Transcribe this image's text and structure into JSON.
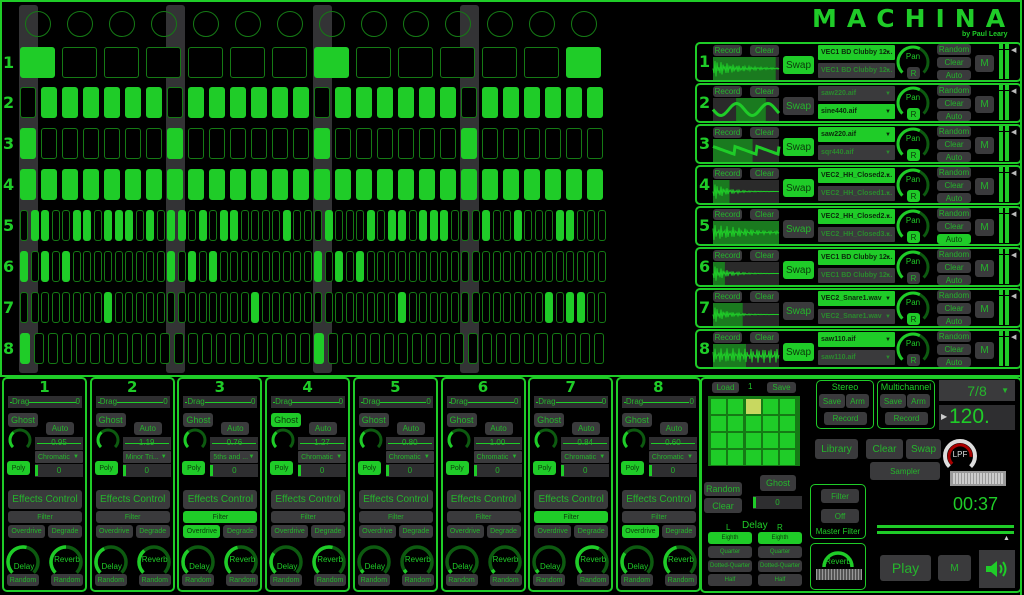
{
  "app": {
    "title": "MACHINA",
    "subtitle": "by Paul Leary"
  },
  "colors": {
    "accent": "#1fcc28",
    "inactive_step_border": "#157a15",
    "button": "#3a3a3c",
    "button_text": "#25b52c",
    "highlight_pad": "#c8d860",
    "background": "#000000"
  },
  "sequencer": {
    "row_labels": [
      "1",
      "2",
      "3",
      "4",
      "5",
      "6",
      "7",
      "8"
    ],
    "rows": [
      {
        "steps": 14,
        "active": [
          0,
          7,
          13
        ]
      },
      {
        "steps": 28,
        "active": [
          1,
          2,
          3,
          4,
          5,
          6,
          8,
          9,
          10,
          11,
          12,
          13,
          15,
          16,
          17,
          18,
          19,
          20,
          22,
          23,
          24,
          25,
          26,
          27
        ]
      },
      {
        "steps": 28,
        "active": [
          0,
          7,
          14,
          21
        ]
      },
      {
        "steps": 28,
        "active": [
          0,
          1,
          2,
          3,
          4,
          5,
          6,
          7,
          8,
          9,
          10,
          11,
          12,
          13,
          14,
          15,
          16,
          17,
          18,
          19,
          20,
          21,
          22,
          23,
          24,
          25,
          26,
          27
        ]
      },
      {
        "steps": 56,
        "active": [
          1,
          2,
          5,
          6,
          8,
          9,
          10,
          12,
          14,
          15,
          17,
          19,
          20,
          25,
          29,
          33,
          35,
          36,
          38,
          39,
          40,
          44,
          47,
          51,
          52
        ]
      },
      {
        "steps": 56,
        "active": [
          0,
          2,
          4,
          14,
          16,
          18,
          28,
          30,
          32
        ]
      },
      {
        "steps": 56,
        "active": [
          8,
          22,
          36,
          50,
          52,
          53
        ]
      },
      {
        "steps": 42,
        "active": [
          0,
          21
        ]
      }
    ]
  },
  "tracks": [
    {
      "number": "1",
      "record": "Record",
      "clear": "Clear",
      "swap": "Swap",
      "swap_active": true,
      "sample_a": "VEC1 BD Clubby 12...",
      "sample_a_active": true,
      "sample_b": "VEC1 BD Clubby 12...",
      "sample_b_active": false,
      "pan": "Pan",
      "r": "R",
      "r_active": false,
      "random": "Random",
      "clear2": "Clear",
      "auto": "Auto",
      "auto_active": false,
      "mute": "M",
      "selection": [
        0,
        0.95
      ]
    },
    {
      "number": "2",
      "record": "Record",
      "clear": "Clear",
      "swap": "Swap",
      "swap_active": false,
      "sample_a": "saw220.aif",
      "sample_a_active": false,
      "sample_b": "sine440.aif",
      "sample_b_active": true,
      "pan": "Pan",
      "r": "R",
      "r_active": true,
      "random": "Random",
      "clear2": "Clear",
      "auto": "Auto",
      "auto_active": false,
      "mute": "M",
      "selection": [
        0.35,
        0.8
      ]
    },
    {
      "number": "3",
      "record": "Record",
      "clear": "Clear",
      "swap": "Swap",
      "swap_active": true,
      "sample_a": "saw220.aif",
      "sample_a_active": true,
      "sample_b": "sqr440.aif",
      "sample_b_active": false,
      "pan": "Pan",
      "r": "R",
      "r_active": true,
      "random": "Random",
      "clear2": "Clear",
      "auto": "Auto",
      "auto_active": false,
      "mute": "M",
      "selection": [
        0,
        0.6
      ]
    },
    {
      "number": "4",
      "record": "Record",
      "clear": "Clear",
      "swap": "Swap",
      "swap_active": true,
      "sample_a": "VEC2_HH_Closed2....",
      "sample_a_active": true,
      "sample_b": "VEC2_HH_Closed1....",
      "sample_b_active": false,
      "pan": "Pan",
      "r": "R",
      "r_active": true,
      "random": "Random",
      "clear2": "Clear",
      "auto": "Auto",
      "auto_active": false,
      "mute": "M",
      "selection": [
        0,
        0.25
      ]
    },
    {
      "number": "5",
      "record": "Record",
      "clear": "Clear",
      "swap": "Swap",
      "swap_active": false,
      "sample_a": "VEC2_HH_Closed2....",
      "sample_a_active": true,
      "sample_b": "VEC2_HH_Closed3....",
      "sample_b_active": false,
      "pan": "Pan",
      "r": "R",
      "r_active": true,
      "random": "Random",
      "clear2": "Clear",
      "auto": "Auto",
      "auto_active": true,
      "mute": "M",
      "selection": [
        0,
        1
      ]
    },
    {
      "number": "6",
      "record": "Record",
      "clear": "Clear",
      "swap": "Swap",
      "swap_active": true,
      "sample_a": "VEC1 BD Clubby 12...",
      "sample_a_active": true,
      "sample_b": "VEC1 BD Clubby 12...",
      "sample_b_active": false,
      "pan": "Pan",
      "r": "R",
      "r_active": false,
      "random": "Random",
      "clear2": "Clear",
      "auto": "Auto",
      "auto_active": false,
      "mute": "M",
      "selection": [
        0,
        0.18
      ]
    },
    {
      "number": "7",
      "record": "Record",
      "clear": "Clear",
      "swap": "Swap",
      "swap_active": false,
      "sample_a": "VEC2_Snare1.wav",
      "sample_a_active": true,
      "sample_b": "VEC2_Snare1.wav",
      "sample_b_active": false,
      "pan": "Pan",
      "r": "R",
      "r_active": true,
      "random": "Random",
      "clear2": "Clear",
      "auto": "Auto",
      "auto_active": false,
      "mute": "M",
      "selection": [
        0,
        0.45
      ]
    },
    {
      "number": "8",
      "record": "Record",
      "clear": "Clear",
      "swap": "Swap",
      "swap_active": true,
      "sample_a": "saw110.aif",
      "sample_a_active": true,
      "sample_b": "saw110.aif",
      "sample_b_active": false,
      "pan": "Pan",
      "r": "R",
      "r_active": false,
      "random": "Random",
      "clear2": "Clear",
      "auto": "Auto",
      "auto_active": false,
      "mute": "M",
      "selection": [
        0,
        0.5
      ]
    }
  ],
  "strips": [
    {
      "number": "1",
      "drag": "Drag",
      "drag_value": "0",
      "ghost": "Ghost",
      "ghost_active": false,
      "auto": "Auto",
      "value": "0.95",
      "scale": "Chromatic",
      "poly": "Poly",
      "offset": "0",
      "effects": "Effects Control",
      "filter": "Filter",
      "filter_active": false,
      "overdrive": "Overdrive",
      "overdrive_active": false,
      "degrade": "Degrade",
      "delay": "Delay",
      "reverb": "Reverb",
      "random": "Random",
      "delay_level": 0.55,
      "reverb_level": 0.5
    },
    {
      "number": "2",
      "drag": "Drag",
      "drag_value": "0",
      "ghost": "Ghost",
      "ghost_active": false,
      "auto": "Auto",
      "value": "1.19",
      "scale": "Minor Tri...",
      "poly": "Poly",
      "offset": "0",
      "effects": "Effects Control",
      "filter": "Filter",
      "filter_active": false,
      "overdrive": "Overdrive",
      "overdrive_active": false,
      "degrade": "Degrade",
      "delay": "Delay",
      "reverb": "Reverb",
      "random": "Random",
      "delay_level": 0.4,
      "reverb_level": 0.35
    },
    {
      "number": "3",
      "drag": "Drag",
      "drag_value": "0",
      "ghost": "Ghost",
      "ghost_active": false,
      "auto": "Auto",
      "value": "0.76",
      "scale": "5ths and ...",
      "poly": "Poly",
      "offset": "0",
      "effects": "Effects Control",
      "filter": "Filter",
      "filter_active": true,
      "overdrive": "Overdrive",
      "overdrive_active": true,
      "degrade": "Degrade",
      "delay": "Delay",
      "reverb": "Reverb",
      "random": "Random",
      "delay_level": 0.35,
      "reverb_level": 0.45
    },
    {
      "number": "4",
      "drag": "Drag",
      "drag_value": "0",
      "ghost": "Ghost",
      "ghost_active": true,
      "auto": "Auto",
      "value": "1.27",
      "scale": "Chromatic",
      "poly": "Poly",
      "offset": "0",
      "effects": "Effects Control",
      "filter": "Filter",
      "filter_active": false,
      "overdrive": "Overdrive",
      "overdrive_active": false,
      "degrade": "Degrade",
      "delay": "Delay",
      "reverb": "Reverb",
      "random": "Random",
      "delay_level": 0.3,
      "reverb_level": 0.55
    },
    {
      "number": "5",
      "drag": "Drag",
      "drag_value": "0",
      "ghost": "Ghost",
      "ghost_active": false,
      "auto": "Auto",
      "value": "0.80",
      "scale": "Chromatic",
      "poly": "Poly",
      "offset": "0",
      "effects": "Effects Control",
      "filter": "Filter",
      "filter_active": false,
      "overdrive": "Overdrive",
      "overdrive_active": false,
      "degrade": "Degrade",
      "delay": "Delay",
      "reverb": "Reverb",
      "random": "Random",
      "delay_level": 0.05,
      "reverb_level": 0.05
    },
    {
      "number": "6",
      "drag": "Drag",
      "drag_value": "0",
      "ghost": "Ghost",
      "ghost_active": false,
      "auto": "Auto",
      "value": "1.00",
      "scale": "Chromatic",
      "poly": "Poly",
      "offset": "0",
      "effects": "Effects Control",
      "filter": "Filter",
      "filter_active": false,
      "overdrive": "Overdrive",
      "overdrive_active": false,
      "degrade": "Degrade",
      "delay": "Delay",
      "reverb": "Reverb",
      "random": "Random",
      "delay_level": 0.05,
      "reverb_level": 0.05
    },
    {
      "number": "7",
      "drag": "Drag",
      "drag_value": "0",
      "ghost": "Ghost",
      "ghost_active": false,
      "auto": "Auto",
      "value": "0.84",
      "scale": "Chromatic",
      "poly": "Poly",
      "offset": "0",
      "effects": "Effects Control",
      "filter": "Filter",
      "filter_active": true,
      "overdrive": "Overdrive",
      "overdrive_active": false,
      "degrade": "Degrade",
      "delay": "Delay",
      "reverb": "Reverb",
      "random": "Random",
      "delay_level": 0.05,
      "reverb_level": 0.6
    },
    {
      "number": "8",
      "drag": "Drag",
      "drag_value": "0",
      "ghost": "Ghost",
      "ghost_active": false,
      "auto": "Auto",
      "value": "0.60",
      "scale": "Chromatic",
      "poly": "Poly",
      "offset": "0",
      "effects": "Effects Control",
      "filter": "Filter",
      "filter_active": false,
      "overdrive": "Overdrive",
      "overdrive_active": true,
      "degrade": "Degrade",
      "delay": "Delay",
      "reverb": "Reverb",
      "random": "Random",
      "delay_level": 0.3,
      "reverb_level": 0.45
    }
  ],
  "master": {
    "load": "Load",
    "pattern_number": "1",
    "save": "Save",
    "pads_total": 20,
    "pad_selected": 2,
    "random": "Random",
    "clear": "Clear",
    "ghost": "Ghost",
    "ghost_value": "0",
    "delay_title": "Delay",
    "delay_left": "L",
    "delay_right": "R",
    "delay_options": [
      "Eighth",
      "Quarter",
      "Dotted-Quarter",
      "Half"
    ],
    "delay_left_selected": "Eighth",
    "delay_right_selected": "Eighth",
    "stereo": {
      "title": "Stereo",
      "save": "Save",
      "arm": "Arm",
      "record": "Record"
    },
    "multichannel": {
      "title": "Multichannel",
      "save": "Save",
      "arm": "Arm",
      "record": "Record"
    },
    "time_signature": "7/8",
    "tempo": "120.",
    "library": "Library",
    "clear2": "Clear",
    "swap": "Swap",
    "sampler": "Sampler",
    "lpf": "LPF",
    "lpf_level": 0.85,
    "filter": "Filter",
    "off": "Off",
    "master_filter": "Master Filter",
    "reverb": "Reverb",
    "reverb_level": 0.5,
    "time": "00:37",
    "play": "Play",
    "mute": "M",
    "speaker_icon": "speaker-icon"
  }
}
